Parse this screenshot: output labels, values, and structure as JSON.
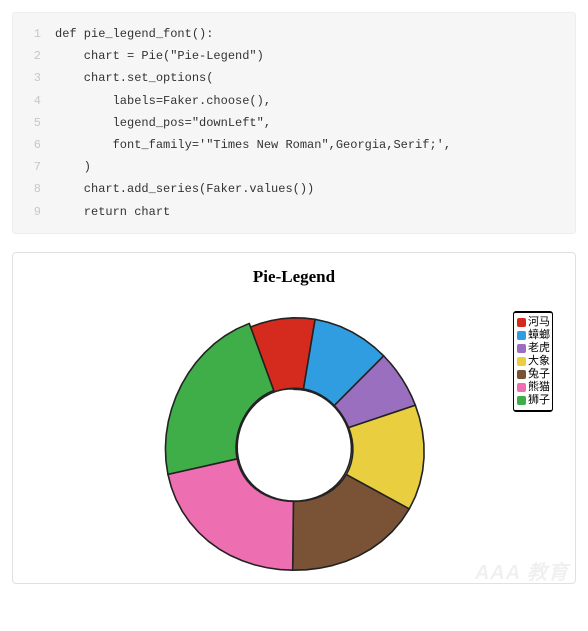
{
  "code": {
    "lines": [
      "def pie_legend_font():",
      "    chart = Pie(\"Pie-Legend\")",
      "    chart.set_options(",
      "        labels=Faker.choose(),",
      "        legend_pos=\"downLeft\",",
      "        font_family='\"Times New Roman\",Georgia,Serif;',",
      "    )",
      "    chart.add_series(Faker.values())",
      "    return chart"
    ]
  },
  "chart_data": {
    "type": "pie",
    "title": "Pie-Legend",
    "donut": true,
    "inner_radius_ratio": 0.45,
    "series": [
      {
        "name": "河马",
        "value": 50,
        "color": "#d52b1e"
      },
      {
        "name": "蟑螂",
        "value": 60,
        "color": "#2f9de0"
      },
      {
        "name": "老虎",
        "value": 45,
        "color": "#9b6fc0"
      },
      {
        "name": "大象",
        "value": 80,
        "color": "#e9cf3f"
      },
      {
        "name": "兔子",
        "value": 105,
        "color": "#7a5336"
      },
      {
        "name": "熊猫",
        "value": 130,
        "color": "#ee6fb1"
      },
      {
        "name": "狮子",
        "value": 140,
        "color": "#3fae49"
      }
    ],
    "legend_position": "right",
    "font_family": "\"Times New Roman\",Georgia,Serif"
  },
  "watermark": "AAA 教育"
}
